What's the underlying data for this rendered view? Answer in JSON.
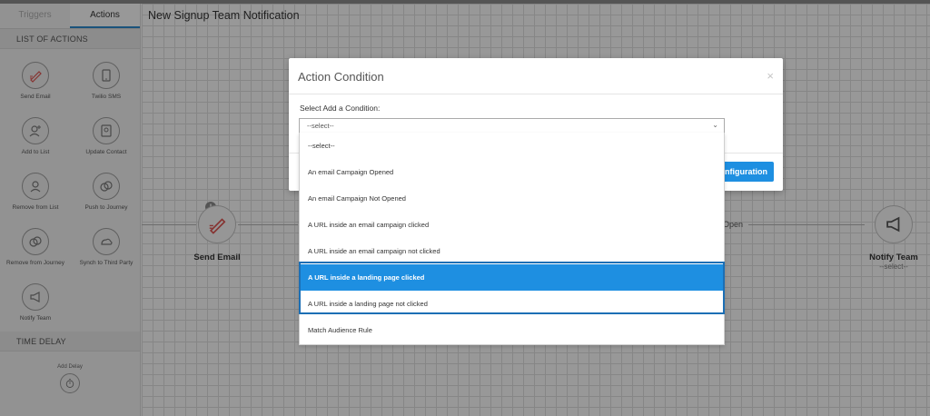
{
  "sidebar": {
    "tabs": [
      "Triggers",
      "Actions"
    ],
    "list_header": "LIST OF ACTIONS",
    "actions": [
      {
        "label": "Send Email",
        "icon": "send-email-icon"
      },
      {
        "label": "Twilio SMS",
        "icon": "sms-icon"
      },
      {
        "label": "Add to List",
        "icon": "add-to-list-icon"
      },
      {
        "label": "Update Contact",
        "icon": "update-contact-icon"
      },
      {
        "label": "Remove from List",
        "icon": "remove-from-list-icon"
      },
      {
        "label": "Push to Journey",
        "icon": "push-to-journey-icon"
      },
      {
        "label": "Remove from Journey",
        "icon": "remove-from-journey-icon"
      },
      {
        "label": "Synch to Third Party",
        "icon": "sync-icon"
      },
      {
        "label": "Notify Team",
        "icon": "megaphone-icon"
      }
    ],
    "time_header": "TIME DELAY",
    "add_delay": "Add Delay"
  },
  "canvas": {
    "title": "New Signup Team Notification",
    "send_email_node": {
      "label": "Send Email",
      "warning": "!"
    },
    "open_label": "Open",
    "notify_node": {
      "label": "Notify Team",
      "sub": "--select--"
    }
  },
  "modal": {
    "title": "Action Condition",
    "close": "×",
    "field_label": "Select Add a Condition:",
    "select_value": "--select--",
    "caret": "⌄",
    "button_label": "Configuration",
    "options": [
      "--select--",
      "An email Campaign Opened",
      "An email Campaign Not Opened",
      "A URL inside an email campaign clicked",
      "A URL inside an email campaign not clicked",
      "A URL inside a landing page clicked",
      "A URL inside a landing page not clicked",
      "Match Audience Rule"
    ],
    "selected_index": 5
  },
  "colors": {
    "accent": "#1e8fe1",
    "focus": "#1c6fb5"
  }
}
